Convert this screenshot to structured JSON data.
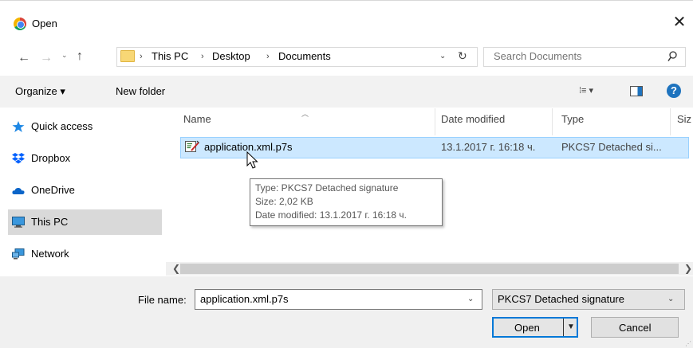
{
  "window": {
    "title": "Open",
    "close_glyph": "✕"
  },
  "address": {
    "crumbs": [
      "This PC",
      "Desktop",
      "Documents"
    ],
    "separator": "›"
  },
  "search": {
    "placeholder": "Search Documents"
  },
  "toolbar": {
    "organize_label": "Organize ▾",
    "new_folder_label": "New folder",
    "view_label": "⁞≡ ▾",
    "help_label": "?"
  },
  "nav": {
    "items": [
      {
        "label": "Quick access",
        "icon": "star-icon"
      },
      {
        "label": "Dropbox",
        "icon": "dropbox-icon"
      },
      {
        "label": "OneDrive",
        "icon": "cloud-icon"
      },
      {
        "label": "This PC",
        "icon": "computer-icon",
        "selected": true
      },
      {
        "label": "Network",
        "icon": "network-icon"
      }
    ]
  },
  "columns": {
    "name": "Name",
    "date": "Date modified",
    "type": "Type",
    "size": "Siz"
  },
  "files": [
    {
      "name": "application.xml.p7s",
      "date": "13.1.2017 г. 16:18 ч.",
      "type": "PKCS7 Detached si...",
      "icon": "signature-file-icon",
      "selected": true
    }
  ],
  "tooltip": {
    "type_line": "Type: PKCS7 Detached signature",
    "size_line": "Size: 2,02 KB",
    "date_line": "Date modified: 13.1.2017 г. 16:18 ч."
  },
  "bottom": {
    "filename_label": "File name:",
    "filename_value": "application.xml.p7s",
    "filter_value": "PKCS7 Detached signature",
    "open_label": "Open",
    "cancel_label": "Cancel"
  },
  "colors": {
    "selection": "#cce8ff",
    "accent": "#0078d7",
    "folder": "#f8d775"
  }
}
